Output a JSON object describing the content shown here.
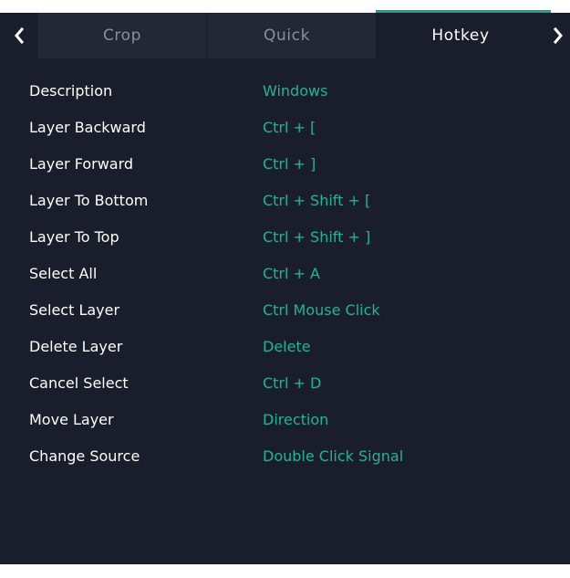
{
  "tabs": {
    "prev_icon": "chevron-left-icon",
    "next_icon": "chevron-right-icon",
    "items": [
      {
        "label": "Crop",
        "active": false
      },
      {
        "label": "Quick",
        "active": false
      },
      {
        "label": "Hotkey",
        "active": true
      }
    ]
  },
  "colors": {
    "background": "#1a1e2c",
    "inactive_tab": "#232837",
    "accent": "#1fa38a",
    "value_text": "#24b392",
    "label_text": "#ffffff"
  },
  "hotkeys": {
    "header": {
      "label": "Description",
      "value": "Windows"
    },
    "rows": [
      {
        "label": "Layer Backward",
        "value": "Ctrl + ["
      },
      {
        "label": "Layer Forward",
        "value": "Ctrl + ]"
      },
      {
        "label": "Layer To Bottom",
        "value": "Ctrl + Shift + ["
      },
      {
        "label": "Layer To Top",
        "value": "Ctrl + Shift + ]"
      },
      {
        "label": "Select All",
        "value": "Ctrl + A"
      },
      {
        "label": "Select Layer",
        "value": "Ctrl Mouse Click"
      },
      {
        "label": "Delete Layer",
        "value": "Delete"
      },
      {
        "label": "Cancel Select",
        "value": "Ctrl + D"
      },
      {
        "label": "Move Layer",
        "value": "Direction"
      },
      {
        "label": "Change Source",
        "value": "Double Click Signal"
      }
    ]
  }
}
